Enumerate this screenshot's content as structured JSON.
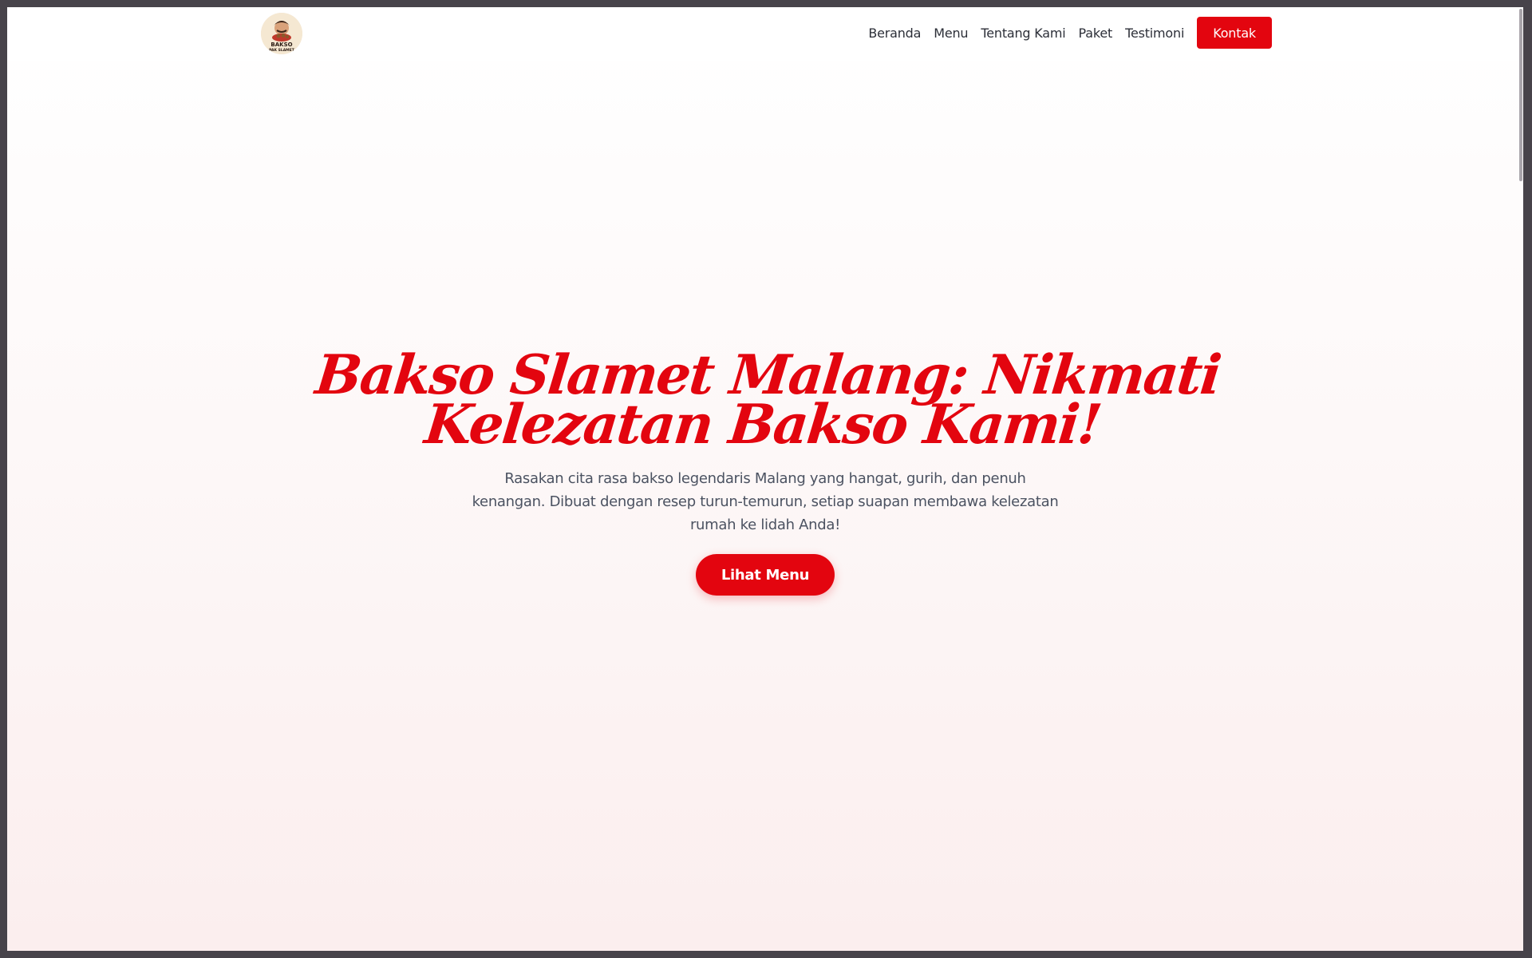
{
  "brand": {
    "logo_icon": "bakso-pak-slamet-logo",
    "logo_text_line1": "BAKSO",
    "logo_text_line2": "PAK SLAMET"
  },
  "nav": {
    "links": [
      "Beranda",
      "Menu",
      "Tentang Kami",
      "Paket",
      "Testimoni"
    ],
    "cta_label": "Kontak"
  },
  "hero": {
    "title": "Bakso Slamet Malang: Nikmati Kelezatan Bakso Kami!",
    "description": "Rasakan cita rasa bakso legendaris Malang yang hangat, gurih, dan penuh kenangan. Dibuat dengan resep turun-temurun, setiap suapan membawa kelezatan rumah ke lidah Anda!",
    "button_label": "Lihat Menu"
  },
  "colors": {
    "accent": "#e3050f",
    "text": "#2c2f38",
    "muted_text": "#4b5261",
    "window_frame": "#47434a"
  }
}
